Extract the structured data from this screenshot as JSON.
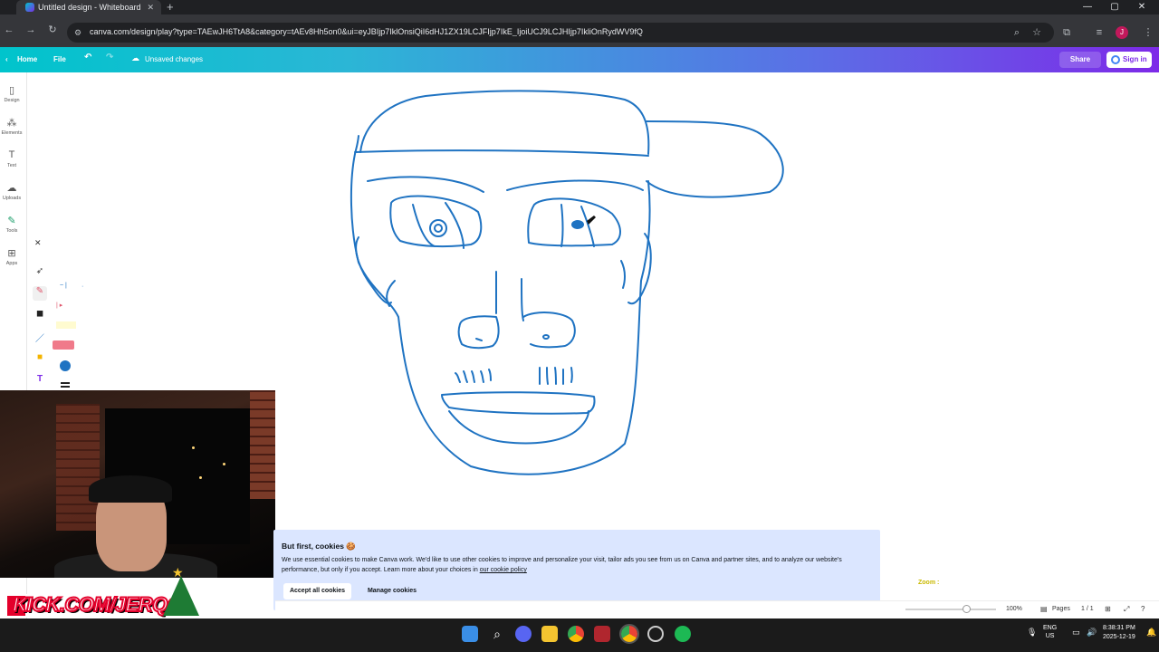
{
  "browser": {
    "tab_title": "Untitled design - Whiteboard",
    "url": "canva.com/design/play?type=TAEwJH6TtA8&category=tAEv8Hh5on0&ui=eyJBIjp7IklOnsiQiI6dHJ1ZX19LCJFIjp7IkE_IjoiUCJ9LCJHIjp7IkliOnRydWV9fQ",
    "profile_initial": "J"
  },
  "canva_header": {
    "home": "Home",
    "file": "File",
    "status": "Unsaved changes",
    "share": "Share",
    "sign_in": "Sign in"
  },
  "sidebar": {
    "items": [
      {
        "label": "Design",
        "icon": "design-icon"
      },
      {
        "label": "Elements",
        "icon": "elements-icon"
      },
      {
        "label": "Text",
        "icon": "text-icon"
      },
      {
        "label": "Uploads",
        "icon": "uploads-icon"
      },
      {
        "label": "Tools",
        "icon": "tools-icon"
      },
      {
        "label": "Apps",
        "icon": "apps-icon"
      }
    ]
  },
  "draw_tools": {
    "colors": {
      "stroke": "#1f73c2",
      "marker": "#f07a8a",
      "swatch": "#1f73c2"
    }
  },
  "cookie_banner": {
    "title": "But first, cookies 🍪",
    "body": "We use essential cookies to make Canva work. We'd like to use other cookies to improve and personalize your visit, tailor ads you see from us on Canva and partner sites, and to analyze our website's performance, but only if you accept. Learn more about your choices in",
    "link": "our cookie policy",
    "accept": "Accept all cookies",
    "manage": "Manage cookies"
  },
  "overlay": {
    "kick": "KICK.COM/JERQO"
  },
  "zoom_widget": "Zoom :",
  "status_bar": {
    "zoom_percent": "100%",
    "zoom_fraction": 0.67,
    "pages_label": "Pages",
    "page_count": "1 / 1"
  },
  "taskbar": {
    "lang": "ENG",
    "region": "US",
    "time": "8:38:31 PM",
    "date": "2025-12-19"
  }
}
